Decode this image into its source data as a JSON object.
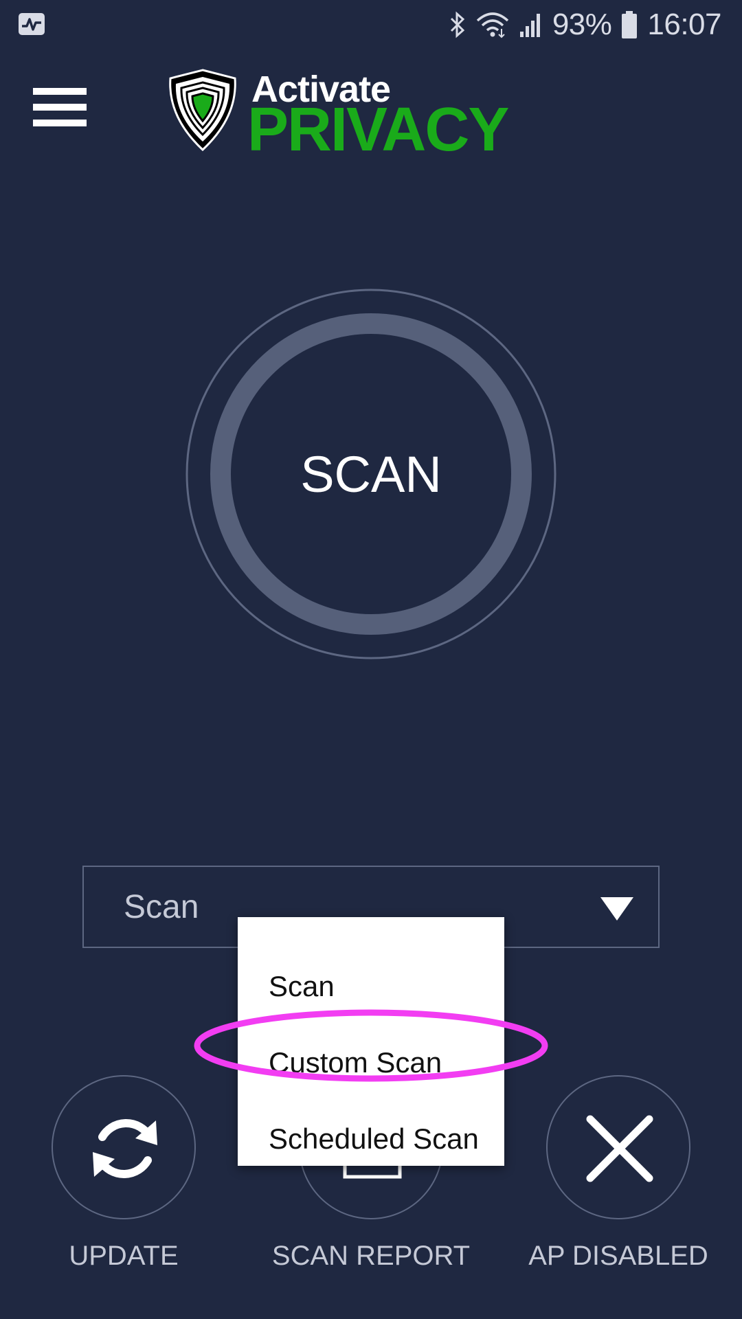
{
  "status_bar": {
    "battery": "93%",
    "time": "16:07",
    "icons": [
      "activity-icon",
      "bluetooth-icon",
      "wifi-icon",
      "signal-icon",
      "battery-icon"
    ]
  },
  "header": {
    "logo_line1": "Activate",
    "logo_line2": "PRIVACY",
    "brand_color": "#1aab1a"
  },
  "scan_dial": {
    "label": "SCAN"
  },
  "scan_select": {
    "selected": "Scan"
  },
  "dropdown": {
    "items": [
      "Scan",
      "Custom Scan",
      "Scheduled Scan"
    ],
    "highlighted": "Custom Scan",
    "highlight_color": "#f23df2"
  },
  "bottom_bar": {
    "update_label": "UPDATE",
    "scan_report_label": "SCAN REPORT",
    "ap_label": "AP DISABLED"
  },
  "colors": {
    "background": "#1f2841",
    "ring": "#56607a",
    "outline": "#5d6782"
  }
}
